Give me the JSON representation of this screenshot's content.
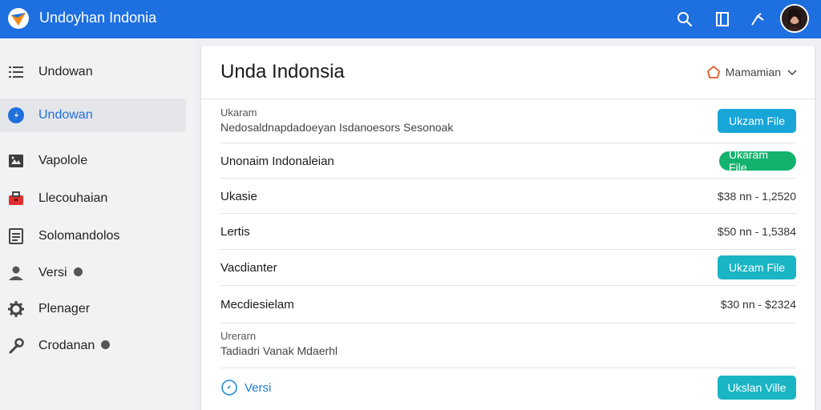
{
  "topbar": {
    "title": "Undoyhan Indonia",
    "icons": [
      "search-icon",
      "bookmark-icon",
      "pen-icon"
    ],
    "accent": "#1e6fe0"
  },
  "sidebar": {
    "items": [
      {
        "label": "Undowan",
        "icon": "list-icon",
        "active": false
      },
      {
        "label": "Undowan",
        "icon": "compass-icon",
        "active": true
      },
      {
        "label": "Vapolole",
        "icon": "image-icon",
        "active": false
      },
      {
        "label": "Llecouhaian",
        "icon": "toolbox-icon",
        "active": false
      },
      {
        "label": "Solomandolos",
        "icon": "document-icon",
        "active": false
      },
      {
        "label": "Versi",
        "icon": "user-icon",
        "active": false
      },
      {
        "label": "Plenager",
        "icon": "gear-icon",
        "active": false
      },
      {
        "label": "Crodanan",
        "icon": "wrench-icon",
        "active": false
      }
    ]
  },
  "main": {
    "title": "Unda Indonsia",
    "menu_label": "Mamamian",
    "rows": [
      {
        "small": "Ukaram",
        "sub": "Nedosaldnapdadoeyan Isdanoesors Sesonoak",
        "button": "Ukzam File"
      },
      {
        "main": "Unonaim Indonaleian",
        "button": "Ukaram File"
      },
      {
        "main": "Ukasie",
        "value": "$38 nn - 1,2520"
      },
      {
        "main": "Lertis",
        "value": "$50 nn - 1,5384"
      },
      {
        "main": "Vacdianter",
        "button": "Ukzam File"
      },
      {
        "main": "Mecdiesielam",
        "value": "$30 nn - $2324"
      },
      {
        "small": "Urerarn",
        "sub": "Tadiadri Vanak Mdaerhl"
      },
      {
        "link": "Versi",
        "button": "Ukslan Ville"
      }
    ],
    "colors": {
      "blue_button": "#18a6d8",
      "green_button": "#13b26d",
      "teal_button": "#1ab5c4"
    }
  }
}
